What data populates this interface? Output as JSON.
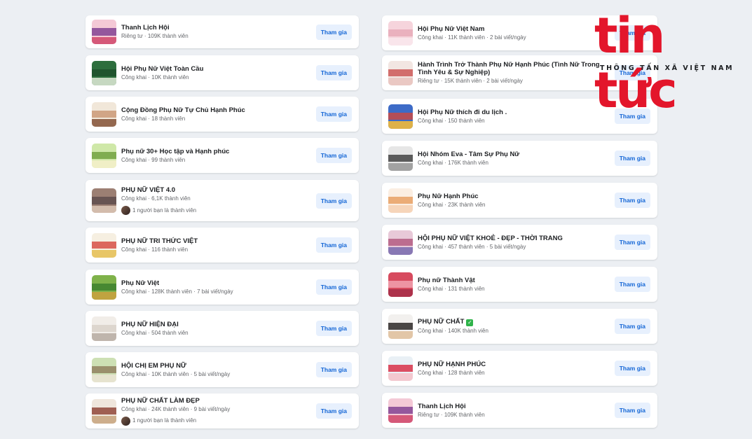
{
  "join_label": "Tham gia",
  "left_groups": [
    {
      "name": "Thanh Lịch Hội",
      "meta": "Riêng tư · 109K thành viên",
      "thumb": [
        "#f4c9d6",
        "#7c3b8f",
        "#d14c6f"
      ]
    },
    {
      "name": "Hội Phụ Nữ Việt Toàn Cầu",
      "meta": "Công khai · 10K thành viên",
      "thumb": [
        "#2d6e3d",
        "#1d4d2a",
        "#d7e3cf"
      ]
    },
    {
      "name": "Cộng Đồng Phụ Nữ Tự Chủ Hạnh Phúc",
      "meta": "Công khai · 18 thành viên",
      "thumb": [
        "#f1e7d9",
        "#c99571",
        "#8a5a3f"
      ]
    },
    {
      "name": "Phụ nữ 30+ Học tập và Hạnh phúc",
      "meta": "Công khai · 99 thành viên",
      "thumb": [
        "#cfe8a8",
        "#6c9d3a",
        "#f3f0c9"
      ]
    },
    {
      "name": "PHỤ NỮ VIỆT 4.0",
      "meta": "Công khai · 6,1K thành viên",
      "friend": "1 người bạn là thành viên",
      "thumb": [
        "#9c7f73",
        "#5b4a4a",
        "#d9c3b3"
      ]
    },
    {
      "name": "PHỤ NỮ TRI THỨC VIỆT",
      "meta": "Công khai · 116 thành viên",
      "thumb": [
        "#f6efe1",
        "#d6453c",
        "#e7c15a"
      ]
    },
    {
      "name": "Phụ Nữ Việt",
      "meta": "Công khai · 128K thành viên · 7 bài viết/ngày",
      "thumb": [
        "#7fb24a",
        "#3a7d2c",
        "#c8a13f"
      ]
    },
    {
      "name": "PHỤ NỮ HIỆN ĐẠI",
      "meta": "Công khai · 504 thành viên",
      "thumb": [
        "#f1ede8",
        "#d8cfc7",
        "#b9aea5"
      ]
    },
    {
      "name": "HỘI CHỊ EM PHỤ NỮ",
      "meta": "Công khai · 10K thành viên · 5 bài viết/ngày",
      "thumb": [
        "#cde0b4",
        "#8d7a5a",
        "#e9e3d1"
      ]
    },
    {
      "name": "PHỤ NỮ CHẤT LÀM ĐẸP",
      "meta": "Công khai · 24K thành viên · 9 bài viết/ngày",
      "friend": "1 người bạn là thành viên",
      "thumb": [
        "#efe6dc",
        "#8b3d2f",
        "#c9a783"
      ]
    }
  ],
  "right_groups": [
    {
      "name": "Hội Phụ Nữ Việt Nam",
      "meta": "Công khai · 11K thành viên · 2 bài viết/ngày",
      "thumb": [
        "#f6d4dc",
        "#e7a7b7",
        "#f9e7ec"
      ]
    },
    {
      "name": "Hành Trình Trở Thành Phụ Nữ Hạnh Phúc (Tình Nữ Trong Tình Yêu & Sự Nghiệp)",
      "meta": "Riêng tư · 15K thành viên · 2 bài viết/ngày",
      "thumb": [
        "#f2e6e2",
        "#c9504f",
        "#e9c4c0"
      ]
    },
    {
      "name": "Hội Phụ Nữ thích đi du lịch .",
      "meta": "Công khai · 150 thành viên",
      "thumb": [
        "#3d6bc7",
        "#d2473c",
        "#f0b93a"
      ]
    },
    {
      "name": "Hội Nhóm Eva - Tâm Sự Phụ Nữ",
      "meta": "Công khai · 176K thành viên",
      "thumb": [
        "#e6e6e6",
        "#3a3a3a",
        "#9a9a9a"
      ]
    },
    {
      "name": "Phụ Nữ Hạnh Phúc",
      "meta": "Công khai · 23K thành viên",
      "thumb": [
        "#fbeee2",
        "#e79b5d",
        "#f5d1b6"
      ]
    },
    {
      "name": "HỘI PHỤ NỮ VIỆT KHOẺ - ĐẸP - THỜI TRANG",
      "meta": "Công khai · 457 thành viên · 5 bài viết/ngày",
      "thumb": [
        "#e8c9d8",
        "#b0567d",
        "#7d6fb0"
      ]
    },
    {
      "name": "Phụ nữ Thành Vật",
      "meta": "Công khai · 131 thành viên",
      "thumb": [
        "#d74a5e",
        "#f2a6b4",
        "#a93049"
      ]
    },
    {
      "name": "PHỤ NỮ CHẤT",
      "meta": "Công khai · 140K thành viên",
      "verified": true,
      "thumb": [
        "#f2f0ee",
        "#1f1b1a",
        "#e0c19f"
      ]
    },
    {
      "name": "PHỤ NỮ HẠNH PHÚC",
      "meta": "Công khai · 128 thành viên",
      "thumb": [
        "#e9f0f5",
        "#d7263d",
        "#f4c3cb"
      ]
    },
    {
      "name": "Thanh Lịch Hội",
      "meta": "Riêng tư · 109K thành viên",
      "thumb": [
        "#f4c9d6",
        "#7c3b8f",
        "#d14c6f"
      ]
    }
  ],
  "logo": {
    "word": "tin tức",
    "tagline": "THÔNG TẤN XÃ VIỆT NAM",
    "color": "#e3162b"
  }
}
